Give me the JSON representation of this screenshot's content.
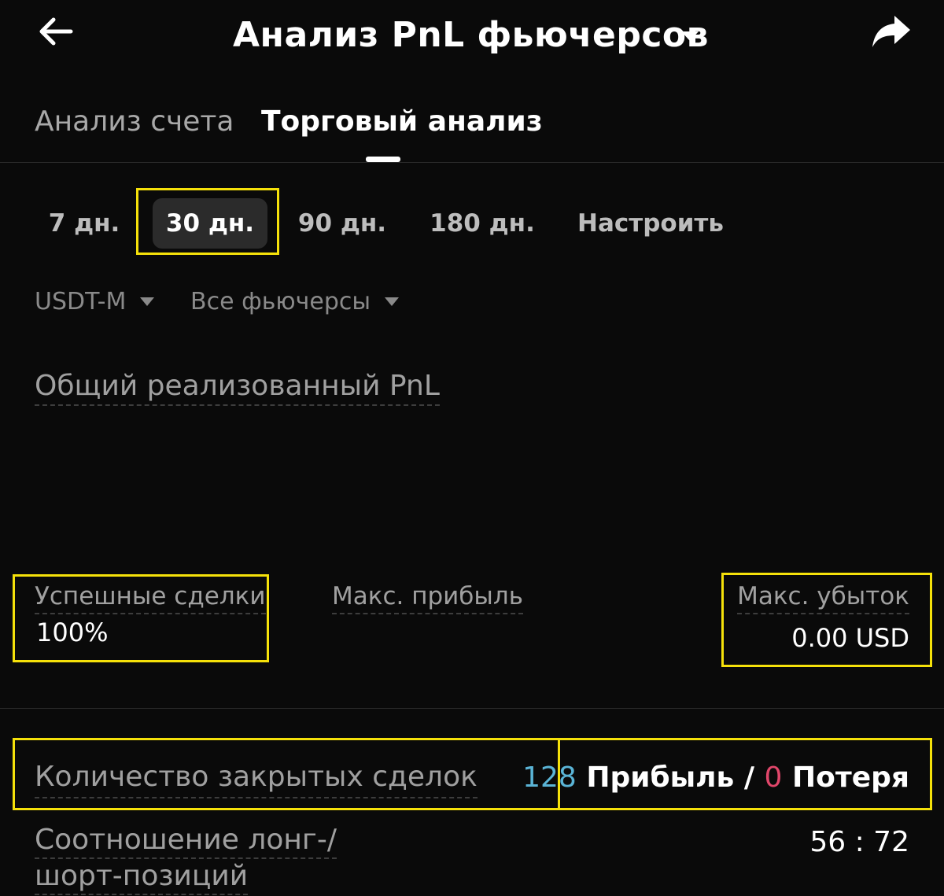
{
  "header": {
    "title": "Анализ PnL фьючерсов",
    "back_icon": "back-arrow-icon",
    "share_icon": "share-icon",
    "dropdown_icon": "caret-down-icon"
  },
  "tabs": [
    {
      "label": "Анализ счета",
      "active": false
    },
    {
      "label": "Торговый анализ",
      "active": true
    }
  ],
  "periods": [
    {
      "label": "7 дн.",
      "selected": false
    },
    {
      "label": "30 дн.",
      "selected": true
    },
    {
      "label": "90 дн.",
      "selected": false
    },
    {
      "label": "180 дн.",
      "selected": false
    },
    {
      "label": "Настроить",
      "selected": false
    }
  ],
  "filters": {
    "margin_type": "USDT-M",
    "contracts": "Все фьючерсы"
  },
  "pnl_section": {
    "title": "Общий реализованный PnL"
  },
  "stats": {
    "win_rate_label": "Успешные сделки",
    "win_rate_value": "100%",
    "max_profit_label": "Макс. прибыль",
    "max_loss_label": "Макс. убыток",
    "max_loss_value": "0.00 USD"
  },
  "closed_trades": {
    "label": "Количество закрытых сделок",
    "profit_count": "128",
    "profit_label": " Прибыль / ",
    "loss_count": "0",
    "loss_label": " Потеря"
  },
  "long_short": {
    "label_line1": "Соотношение лонг-/",
    "label_line2": "шорт-позиций",
    "value": "56 : 72"
  },
  "colors": {
    "background": "#0a0a0a",
    "highlight": "#f5e10a",
    "profit": "#5ab4d6",
    "loss": "#e0466a"
  }
}
